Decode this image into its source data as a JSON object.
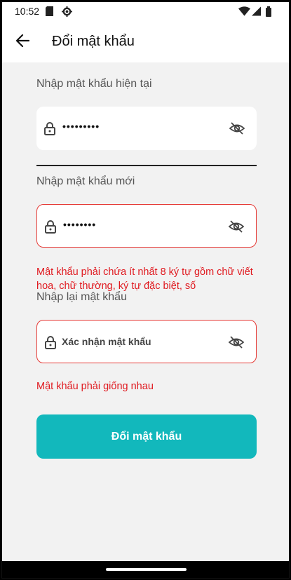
{
  "status_bar": {
    "time": "10:52",
    "icons": [
      "sim-card-icon",
      "settings-icon",
      "wifi-icon",
      "signal-icon",
      "battery-icon"
    ]
  },
  "app_bar": {
    "back_icon": "arrow-left-icon",
    "title": "Đổi mật khẩu"
  },
  "form": {
    "current_password": {
      "label": "Nhập mật khẩu hiện tại",
      "value": "•••••••••",
      "icons": [
        "lock-icon",
        "eye-off-icon"
      ]
    },
    "new_password": {
      "label": "Nhập mật khẩu mới",
      "value": "••••••••",
      "error": "Mật khẩu phải chứa ít nhất 8 ký tự gồm chữ viết hoa, chữ thường, ký tự đặc biệt, số"
    },
    "confirm_password": {
      "label": "Nhập lại mật khẩu",
      "placeholder": "Xác nhận mật khẩu",
      "error": "Mật khẩu phải giống nhau"
    },
    "submit_label": "Đổi mật khẩu"
  },
  "colors": {
    "accent": "#12b8bc",
    "error": "#e0191f",
    "background": "#f2f2f2"
  }
}
